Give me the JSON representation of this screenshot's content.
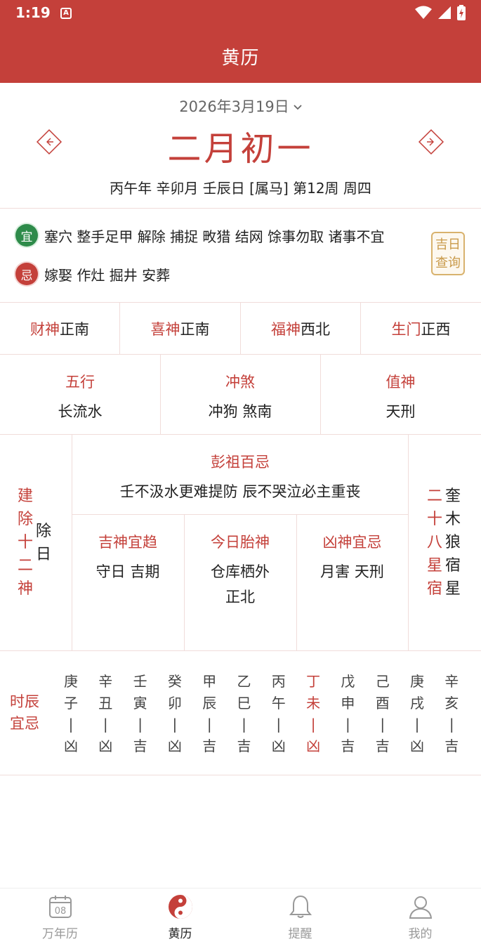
{
  "status": {
    "time": "1:19",
    "notif_icon": "A"
  },
  "header": {
    "title": "黄历"
  },
  "date": {
    "solar": "2026年3月19日",
    "lunar": "二月初一",
    "ganzhi": "丙午年 辛卯月 壬辰日 [属马] 第12周 周四"
  },
  "yiji": {
    "yi_badge": "宜",
    "yi_text": "塞穴 整手足甲 解除 捕捉 畋猎 结网 馀事勿取 诸事不宜",
    "ji_badge": "忌",
    "ji_text": "嫁娶 作灶 掘井 安葬",
    "lookup_line1": "吉日",
    "lookup_line2": "查询"
  },
  "gods": [
    {
      "label": "财神",
      "value": "正南"
    },
    {
      "label": "喜神",
      "value": "正南"
    },
    {
      "label": "福神",
      "value": "西北"
    },
    {
      "label": "生门",
      "value": "正西"
    }
  ],
  "info": [
    {
      "label": "五行",
      "value": "长流水"
    },
    {
      "label": "冲煞",
      "value": "冲狗 煞南"
    },
    {
      "label": "值神",
      "value": "天刑"
    }
  ],
  "jianchu": {
    "label": [
      "建",
      "除",
      "十",
      "二",
      "神"
    ],
    "value": [
      "除",
      "日"
    ]
  },
  "pengzu": {
    "label": "彭祖百忌",
    "value": "壬不汲水更难提防 辰不哭泣必主重丧"
  },
  "mid": [
    {
      "label": "吉神宜趋",
      "value": "守日 吉期"
    },
    {
      "label": "今日胎神",
      "value": "仓库栖外",
      "value2": "正北"
    },
    {
      "label": "凶神宜忌",
      "value": "月害 天刑"
    }
  ],
  "xiu": {
    "label": [
      "二",
      "十",
      "八",
      "星",
      "宿"
    ],
    "value": [
      "奎",
      "木",
      "狼",
      "宿",
      "星"
    ]
  },
  "hours": {
    "label": [
      "时辰",
      "宜忌"
    ],
    "items": [
      {
        "gan": "庚",
        "zhi": "子",
        "sep": "|",
        "luck": "凶",
        "active": false
      },
      {
        "gan": "辛",
        "zhi": "丑",
        "sep": "|",
        "luck": "凶",
        "active": false
      },
      {
        "gan": "壬",
        "zhi": "寅",
        "sep": "|",
        "luck": "吉",
        "active": false
      },
      {
        "gan": "癸",
        "zhi": "卯",
        "sep": "|",
        "luck": "凶",
        "active": false
      },
      {
        "gan": "甲",
        "zhi": "辰",
        "sep": "|",
        "luck": "吉",
        "active": false
      },
      {
        "gan": "乙",
        "zhi": "巳",
        "sep": "|",
        "luck": "吉",
        "active": false
      },
      {
        "gan": "丙",
        "zhi": "午",
        "sep": "|",
        "luck": "凶",
        "active": false
      },
      {
        "gan": "丁",
        "zhi": "未",
        "sep": "|",
        "luck": "凶",
        "active": true
      },
      {
        "gan": "戊",
        "zhi": "申",
        "sep": "|",
        "luck": "吉",
        "active": false
      },
      {
        "gan": "己",
        "zhi": "酉",
        "sep": "|",
        "luck": "吉",
        "active": false
      },
      {
        "gan": "庚",
        "zhi": "戌",
        "sep": "|",
        "luck": "凶",
        "active": false
      },
      {
        "gan": "辛",
        "zhi": "亥",
        "sep": "|",
        "luck": "吉",
        "active": false
      }
    ]
  },
  "bottom_nav": [
    {
      "label": "万年历",
      "icon": "calendar-icon",
      "day": "08"
    },
    {
      "label": "黄历",
      "icon": "yin-yang-icon"
    },
    {
      "label": "提醒",
      "icon": "bell-icon"
    },
    {
      "label": "我的",
      "icon": "user-icon"
    }
  ],
  "colors": {
    "primary": "#c4403a",
    "yi_green": "#2e8b4a",
    "seal_gold": "#c99a4a"
  }
}
